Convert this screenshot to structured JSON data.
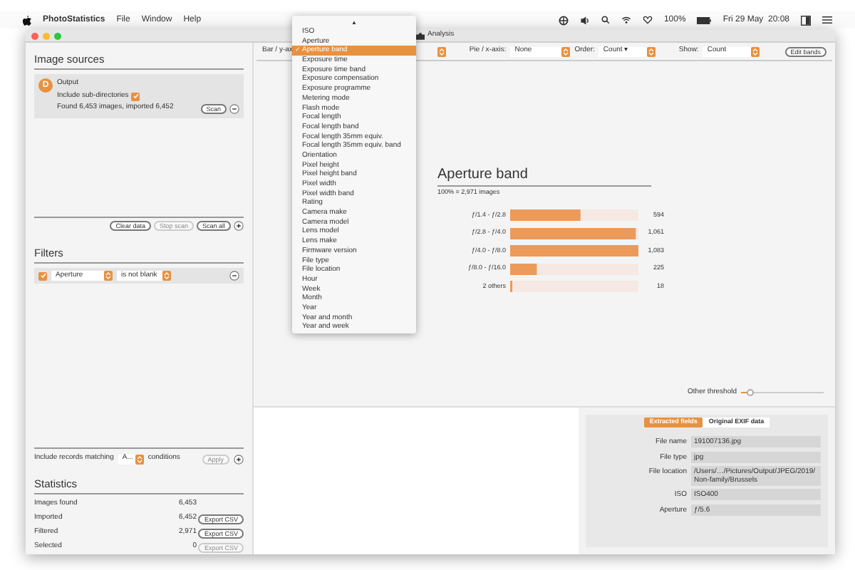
{
  "menubar": {
    "app": "PhotoStatistics",
    "menus": [
      "File",
      "Window",
      "Help"
    ],
    "battery": "100%",
    "clock": "Fri 29 May  20:08"
  },
  "window": {
    "tab": "Analysis"
  },
  "sidebar": {
    "image_sources": {
      "title": "Image sources",
      "sources": [
        {
          "avatar": "D",
          "name": "Output",
          "include_label": "Include sub-directories",
          "include_checked": true,
          "status": "Found 6,453 images, imported 6,452",
          "scan": "Scan"
        }
      ],
      "buttons": [
        {
          "label": "Clear data",
          "disabled": false
        },
        {
          "label": "Stop scan",
          "disabled": true
        },
        {
          "label": "Scan all",
          "disabled": false
        }
      ]
    },
    "filters": {
      "title": "Filters",
      "rows": [
        {
          "checked": true,
          "field": "Aperture",
          "condition": "is not blank"
        }
      ],
      "match_prefix": "Include records matching",
      "match_value": "A...",
      "match_suffix": "conditions",
      "apply": "Apply",
      "apply_disabled": true
    },
    "statistics": {
      "title": "Statistics",
      "rows": [
        {
          "label": "Images found",
          "value": "6,453"
        },
        {
          "label": "Imported",
          "value": "6,452",
          "button": "Export CSV",
          "disabled": false
        },
        {
          "label": "Filtered",
          "value": "2,971",
          "button": "Export CSV",
          "disabled": false
        },
        {
          "label": "Selected",
          "value": "0",
          "button": "Export CSV",
          "disabled": true
        }
      ]
    }
  },
  "toolbar": {
    "bar_label": "Bar / y-ax",
    "pie_label": "Pie / x-axis:",
    "pie_value": "None",
    "order_label": "Order:",
    "order_value": "Count ▾",
    "show_label": "Show:",
    "show_value": "Count",
    "edit": "Edit bands"
  },
  "dropdown": {
    "arrow": "▲",
    "check_mark": "✓",
    "items": [
      {
        "label": "ISO",
        "selected": false
      },
      {
        "label": "Aperture",
        "selected": false
      },
      {
        "label": "Aperture band",
        "selected": true
      },
      {
        "label": "Exposure time",
        "selected": false
      },
      {
        "label": "Exposure time band",
        "selected": false
      },
      {
        "label": "Exposure compensation",
        "selected": false
      },
      {
        "label": "Exposure programme",
        "selected": false
      },
      {
        "label": "Metering mode",
        "selected": false
      },
      {
        "label": "Flash mode",
        "selected": false
      },
      {
        "label": "Focal length",
        "selected": false
      },
      {
        "label": "Focal length band",
        "selected": false
      },
      {
        "label": "Focal length 35mm equiv.",
        "selected": false
      },
      {
        "label": "Focal length 35mm equiv. band",
        "selected": false
      },
      {
        "label": "Orientation",
        "selected": false
      },
      {
        "label": "Pixel height",
        "selected": false
      },
      {
        "label": "Pixel height band",
        "selected": false
      },
      {
        "label": "Pixel width",
        "selected": false
      },
      {
        "label": "Pixel width band",
        "selected": false
      },
      {
        "label": "Rating",
        "selected": false
      },
      {
        "label": "Camera make",
        "selected": false
      },
      {
        "label": "Camera model",
        "selected": false
      },
      {
        "label": "Lens model",
        "selected": false
      },
      {
        "label": "Lens make",
        "selected": false
      },
      {
        "label": "Firmware version",
        "selected": false
      },
      {
        "label": "File type",
        "selected": false
      },
      {
        "label": "File location",
        "selected": false
      },
      {
        "label": "Hour",
        "selected": false
      },
      {
        "label": "Week",
        "selected": false
      },
      {
        "label": "Month",
        "selected": false
      },
      {
        "label": "Year",
        "selected": false
      },
      {
        "label": "Year and month",
        "selected": false
      },
      {
        "label": "Year and week",
        "selected": false
      }
    ]
  },
  "chart": {
    "title": "Aperture band",
    "subtitle": "100% = 2,971 images",
    "chart_data": {
      "type": "bar",
      "orientation": "horizontal",
      "categories": [
        "ƒ/1.4 - ƒ/2.8",
        "ƒ/2.8 - ƒ/4.0",
        "ƒ/4.0 - ƒ/8.0",
        "ƒ/8.0 - ƒ/16.0",
        "2 others"
      ],
      "values": [
        594,
        1061,
        1083,
        225,
        18
      ],
      "value_labels": [
        "594",
        "1,061",
        "1,083",
        "225",
        "18"
      ]
    }
  },
  "threshold": {
    "label": "Other threshold",
    "level": 0.1
  },
  "details": {
    "tabs": [
      {
        "label": "Extracted fields",
        "selected": true
      },
      {
        "label": "Original EXIF data",
        "selected": false
      }
    ],
    "fields": [
      {
        "label": "File name",
        "value": "191007136.jpg"
      },
      {
        "label": "File type",
        "value": "jpg"
      },
      {
        "label": "File location",
        "value": "/Users/…/Pictures/Output/JPEG/2019/Non-family/Brussels"
      },
      {
        "label": "ISO",
        "value": "ISO400"
      },
      {
        "label": "Aperture",
        "value": "ƒ/5.6"
      }
    ]
  }
}
